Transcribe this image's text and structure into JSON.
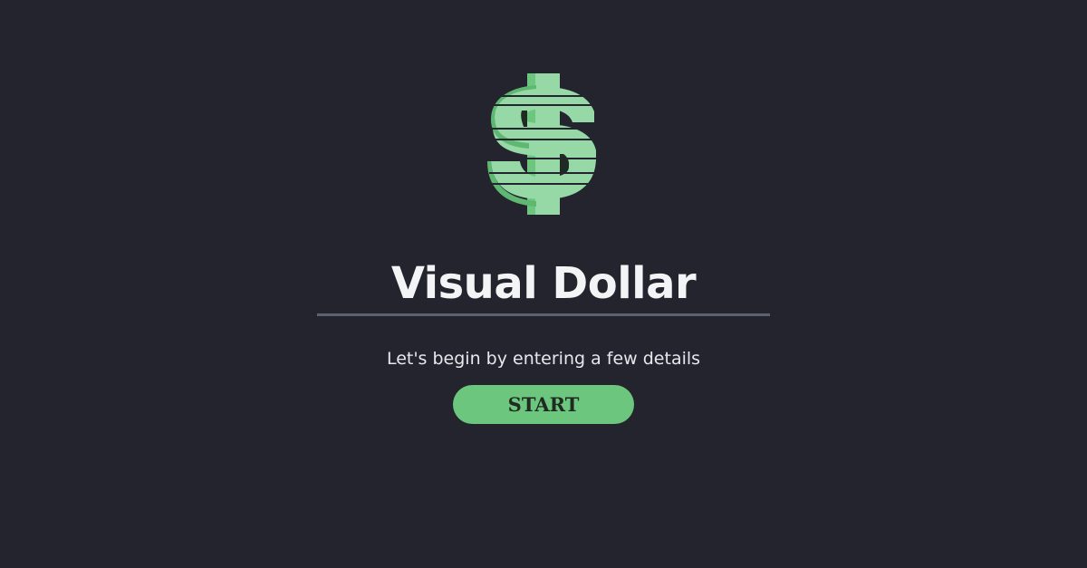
{
  "app": {
    "title": "Visual Dollar",
    "subtitle": "Let's begin by entering a few details",
    "start_label": "START",
    "logo_icon": "dollar-sign-icon"
  },
  "colors": {
    "background": "#23242e",
    "accent": "#6cc67d",
    "divider": "#5d6271",
    "text": "#f4f4f6"
  }
}
